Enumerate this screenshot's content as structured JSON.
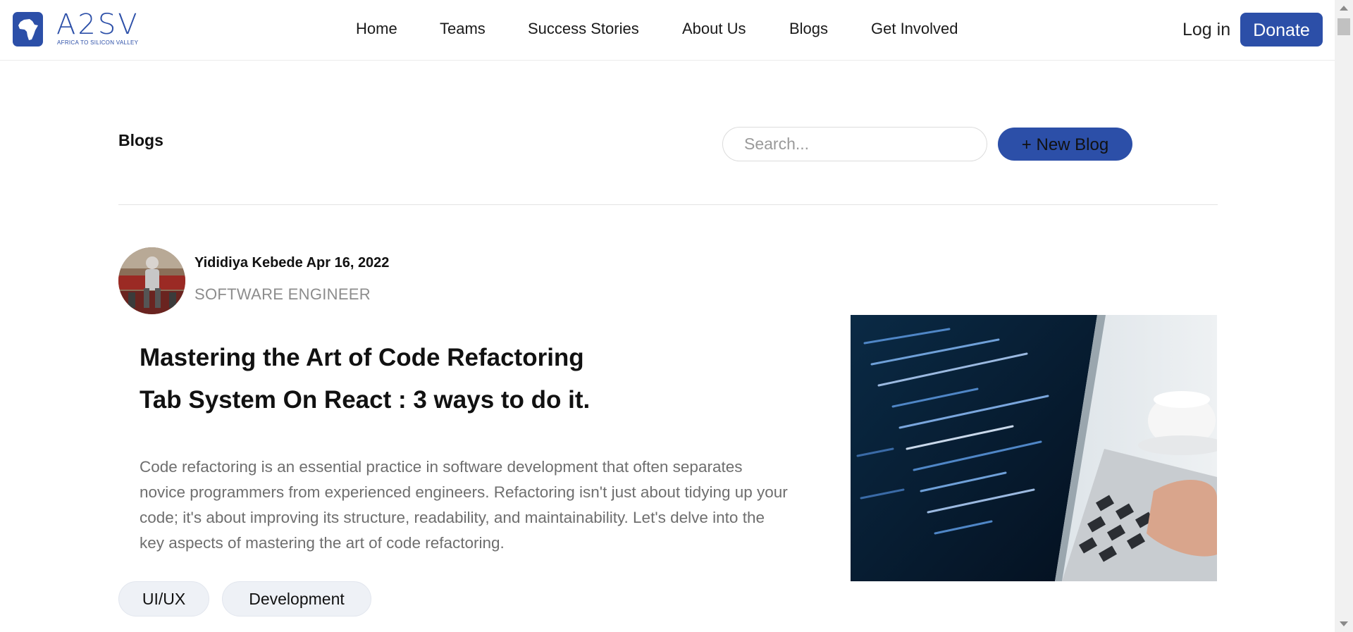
{
  "header": {
    "logo_text": "A2SV",
    "logo_subtitle": "AFRICA TO SILICON VALLEY",
    "nav": [
      {
        "label": "Home"
      },
      {
        "label": "Teams"
      },
      {
        "label": "Success Stories"
      },
      {
        "label": "About Us"
      },
      {
        "label": "Blogs"
      },
      {
        "label": "Get Involved"
      }
    ],
    "login_label": "Log in",
    "donate_label": "Donate"
  },
  "toolbar": {
    "title": "Blogs",
    "search_placeholder": "Search...",
    "new_blog_label": "+ New Blog"
  },
  "post": {
    "author": "Yididiya Kebede",
    "date": "Apr 16, 2022",
    "role": "SOFTWARE ENGINEER",
    "title_lines": [
      "Mastering the Art of Code Refactoring",
      "Tab System On React : 3 ways to do it."
    ],
    "excerpt": "Code refactoring is an essential practice in software development that often separates novice programmers from experienced engineers. Refactoring isn't just about tidying up your code; it's about improving its structure, readability, and maintainability. Let's delve into the key aspects of mastering the art of code refactoring.",
    "tags": [
      "UI/UX",
      "Development"
    ]
  },
  "colors": {
    "brand": "#2c4fa8",
    "muted_text": "#6e6e6e",
    "tag_bg": "#eef1f6"
  }
}
